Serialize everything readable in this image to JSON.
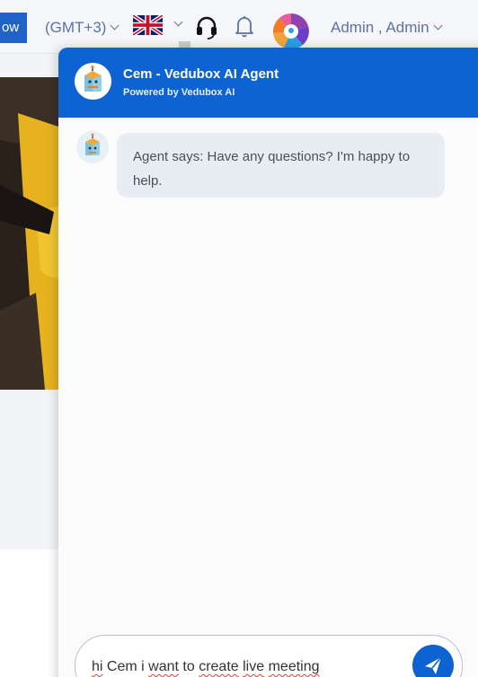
{
  "topbar": {
    "now_label": "ow",
    "timezone": "(GMT+3)",
    "language_icon": "uk-flag-icon",
    "support_icon": "headset-icon",
    "notifications_icon": "bell-icon",
    "user_name": "Admin , Admin"
  },
  "chat": {
    "title": "Cem - Vedubox AI Agent",
    "subtitle": "Powered by Vedubox AI",
    "messages": [
      {
        "sender": "agent",
        "text": "Agent says: Have any questions? I'm happy to help."
      }
    ],
    "input_words": [
      "hi",
      "Cem",
      "i",
      "want",
      "to",
      "create",
      "live",
      "meeting"
    ],
    "send_icon": "paper-plane-icon"
  },
  "colors": {
    "brand_blue": "#0d63d2",
    "topbar_text": "#5b73a8",
    "bubble_bg": "#e8ecf3"
  }
}
